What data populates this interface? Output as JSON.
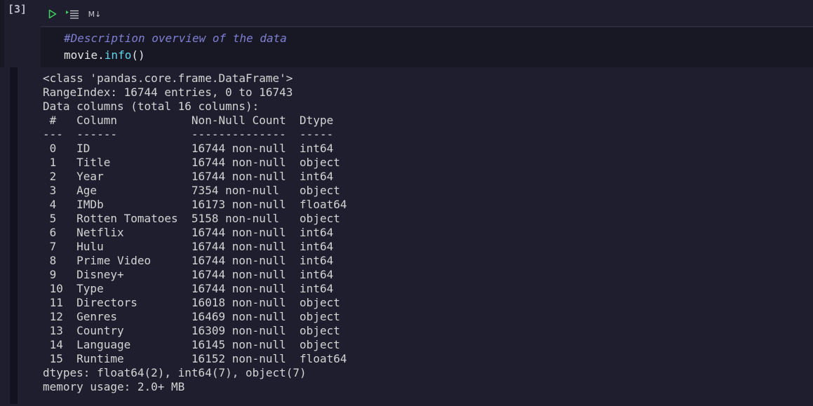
{
  "cell": {
    "execution_count": "[3]",
    "toolbar": {
      "run_icon": "play-icon",
      "run_below_icon": "run-below-icon",
      "markdown_label": "M↓"
    },
    "code": {
      "comment": "#Description overview of the data",
      "object": "movie.",
      "method": "info",
      "args": "()"
    }
  },
  "output": {
    "lines": [
      "<class 'pandas.core.frame.DataFrame'>",
      "RangeIndex: 16744 entries, 0 to 16743",
      "Data columns (total 16 columns):",
      " #   Column           Non-Null Count  Dtype  ",
      "---  ------           --------------  -----  ",
      " 0   ID               16744 non-null  int64  ",
      " 1   Title            16744 non-null  object ",
      " 2   Year             16744 non-null  int64  ",
      " 3   Age              7354 non-null   object ",
      " 4   IMDb             16173 non-null  float64",
      " 5   Rotten Tomatoes  5158 non-null   object ",
      " 6   Netflix          16744 non-null  int64  ",
      " 7   Hulu             16744 non-null  int64  ",
      " 8   Prime Video      16744 non-null  int64  ",
      " 9   Disney+          16744 non-null  int64  ",
      " 10  Type             16744 non-null  int64  ",
      " 11  Directors        16018 non-null  object ",
      " 12  Genres           16469 non-null  object ",
      " 13  Country          16309 non-null  object ",
      " 14  Language         16145 non-null  object ",
      " 15  Runtime          16152 non-null  float64",
      "dtypes: float64(2), int64(7), object(7)",
      "memory usage: 2.0+ MB"
    ]
  },
  "colors": {
    "background": "#1e1e2e",
    "code_background": "#181825",
    "comment": "#7f7fd4",
    "function": "#5fd7e8",
    "run_icon": "#3fcf5f"
  }
}
